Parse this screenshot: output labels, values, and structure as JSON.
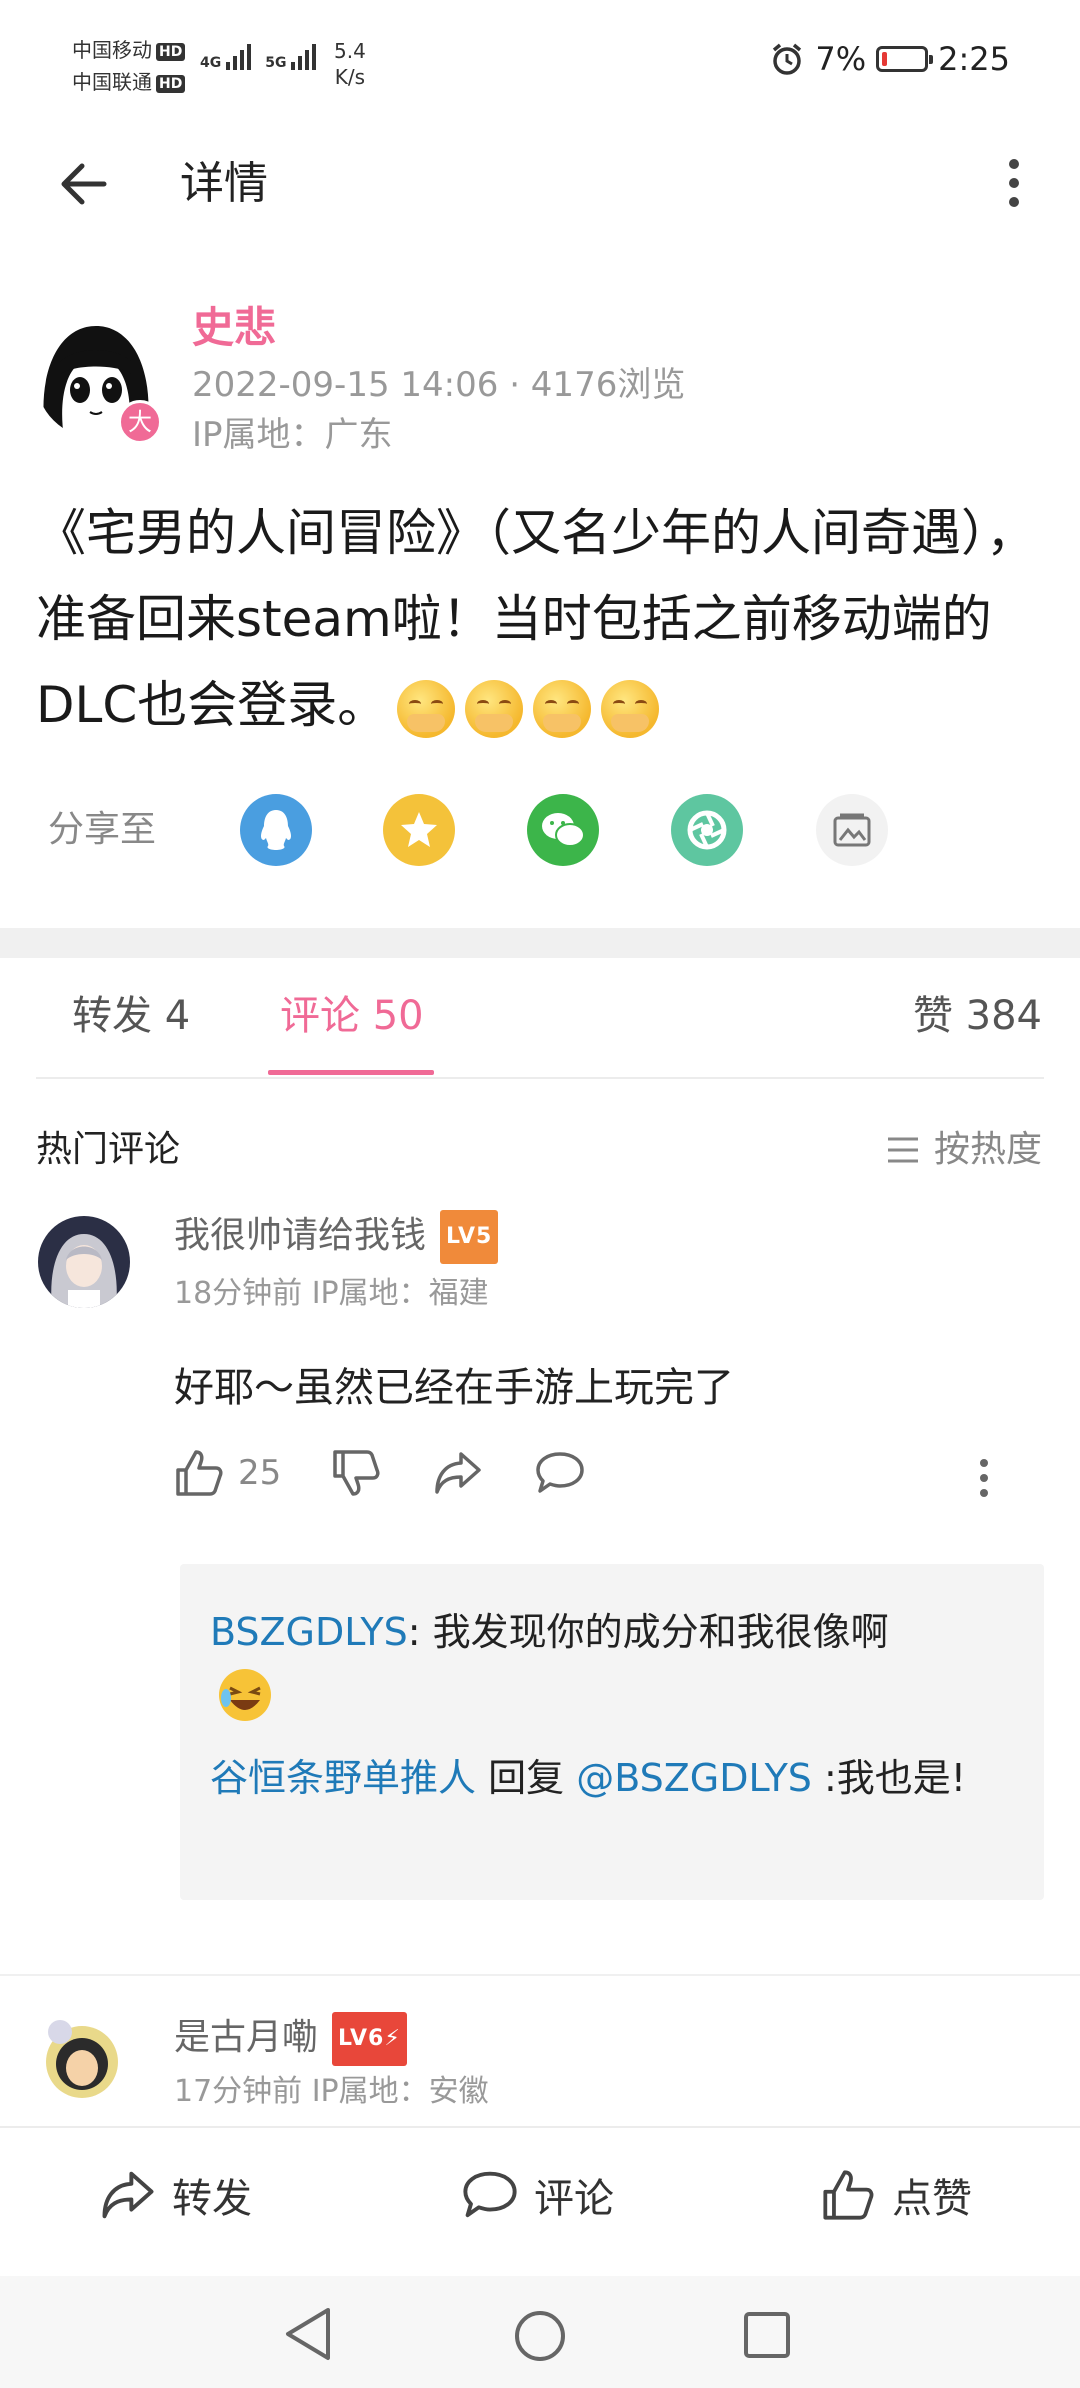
{
  "status_bar": {
    "carrier1": "中国移动",
    "carrier2": "中国联通",
    "hd": "HD",
    "net1": "4G",
    "net2": "5G",
    "speed_value": "5.4",
    "speed_unit": "K/s",
    "battery": "7%",
    "time": "2:25"
  },
  "header": {
    "title": "详情"
  },
  "post": {
    "author": "史悲",
    "author_badge": "大",
    "meta": "2022-09-15 14:06 · 4176浏览",
    "ip": "IP属地：广东",
    "content": "《宅男的人间冒险》（又名少年的人间奇遇），准备回来steam啦！当时包括之前移动端的DLC也会登录。",
    "emojis": [
      "cover-mouth-emoji",
      "cover-mouth-emoji",
      "cover-mouth-emoji",
      "cover-mouth-emoji"
    ]
  },
  "share": {
    "label": "分享至",
    "targets": [
      {
        "icon": "qq-icon",
        "color": "#4a9ee0"
      },
      {
        "icon": "qzone-star-icon",
        "color": "#f4c23a"
      },
      {
        "icon": "wechat-icon",
        "color": "#3cb54a"
      },
      {
        "icon": "moments-icon",
        "color": "#5ec6a0"
      },
      {
        "icon": "image-icon",
        "color": "#f2f2f2"
      }
    ]
  },
  "tabs": {
    "repost": "转发 4",
    "comments": "评论 50",
    "likes": "赞 384"
  },
  "hot": {
    "title": "热门评论",
    "sort": "按热度"
  },
  "comments": [
    {
      "name": "我很帅请给我钱",
      "level": "LV5",
      "level_color": "#f08a3a",
      "meta": "18分钟前  IP属地：福建",
      "text": "好耶～虽然已经在手游上玩完了",
      "likes": "25",
      "replies": [
        {
          "user": "BSZGDLYS",
          "text": ": 我发现你的成分和我很像啊"
        },
        {
          "user": "谷恒条野单推人",
          "reply_word": " 回复 ",
          "target": "@BSZGDLYS",
          "text": " :我也是!"
        }
      ]
    },
    {
      "name": "是古月嘞",
      "level": "LV6⚡",
      "level_color": "#e8473a",
      "meta": "17分钟前  IP属地：安徽"
    }
  ],
  "bottom_bar": {
    "repost": "转发",
    "comment": "评论",
    "like": "点赞"
  }
}
